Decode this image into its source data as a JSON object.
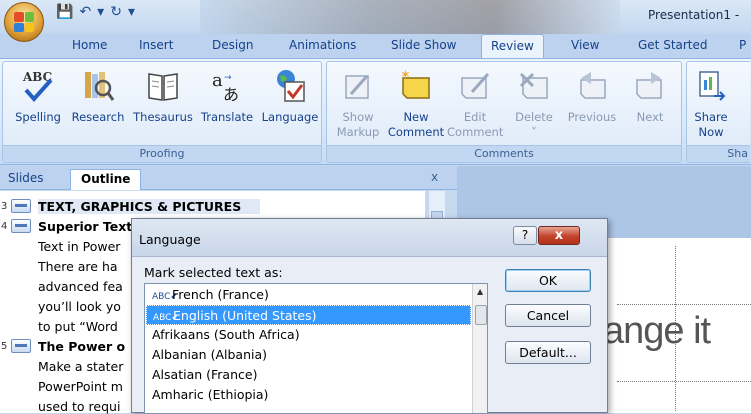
{
  "window": {
    "title": "Presentation1 -"
  },
  "tabs": [
    "Home",
    "Insert",
    "Design",
    "Animations",
    "Slide Show",
    "Review",
    "View",
    "Get Started",
    "P"
  ],
  "active_tab": "Review",
  "ribbon": {
    "proofing": {
      "label": "Proofing",
      "buttons": [
        "Spelling",
        "Research",
        "Thesaurus",
        "Translate",
        "Language"
      ]
    },
    "comments": {
      "label": "Comments",
      "buttons": [
        {
          "line1": "Show",
          "line2": "Markup"
        },
        {
          "line1": "New",
          "line2": "Comment"
        },
        {
          "line1": "Edit",
          "line2": "Comment"
        },
        {
          "line1": "Delete",
          "line2": "˅"
        },
        {
          "line1": "Previous",
          "line2": ""
        },
        {
          "line1": "Next",
          "line2": ""
        }
      ]
    },
    "share": {
      "label": "Sha",
      "line1": "Share",
      "line2": "Now"
    }
  },
  "pane": {
    "tab_slides": "Slides",
    "tab_outline": "Outline",
    "close": "x"
  },
  "outline": [
    {
      "num": "3",
      "text": "TEXT, GRAPHICS & PICTURES",
      "bold": true,
      "icon": true
    },
    {
      "num": "4",
      "text": "Superior Text",
      "bold": true,
      "icon": true
    },
    {
      "num": "",
      "text": "Text in Power",
      "bold": false,
      "icon": false
    },
    {
      "num": "",
      "text": "There are ha",
      "bold": false,
      "icon": false
    },
    {
      "num": "",
      "text": "advanced fea",
      "bold": false,
      "icon": false
    },
    {
      "num": "",
      "text": "you’ll look yo",
      "bold": false,
      "icon": false
    },
    {
      "num": "",
      "text": "to put “Word",
      "bold": false,
      "icon": false
    },
    {
      "num": "5",
      "text": "The Power o",
      "bold": true,
      "icon": true
    },
    {
      "num": "",
      "text": "Make a stater",
      "bold": false,
      "icon": false
    },
    {
      "num": "",
      "text": "PowerPoint m",
      "bold": false,
      "icon": false
    },
    {
      "num": "",
      "text": "used to requi",
      "bold": false,
      "icon": false
    }
  ],
  "slide": {
    "text": "ange it"
  },
  "dialog": {
    "title": "Language",
    "help": "?",
    "close": "x",
    "label": "Mark selected text as:",
    "items": [
      {
        "text": "French (France)",
        "check": true,
        "selected": false
      },
      {
        "text": "English (United States)",
        "check": true,
        "selected": true
      },
      {
        "text": "Afrikaans (South Africa)",
        "check": false,
        "selected": false
      },
      {
        "text": "Albanian (Albania)",
        "check": false,
        "selected": false
      },
      {
        "text": "Alsatian (France)",
        "check": false,
        "selected": false
      },
      {
        "text": "Amharic (Ethiopia)",
        "check": false,
        "selected": false
      }
    ],
    "ok": "OK",
    "cancel": "Cancel",
    "default": "Default..."
  }
}
